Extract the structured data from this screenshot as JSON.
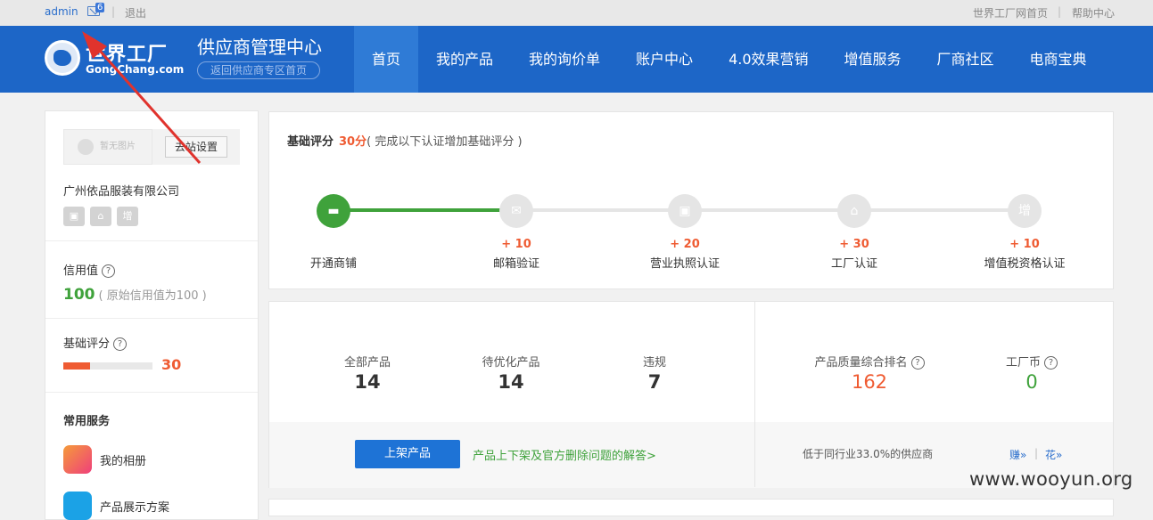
{
  "topbar": {
    "username": "admin",
    "mail_count": "6",
    "separator": "|",
    "logout": "退出",
    "site_home": "世界工厂网首页",
    "help": "帮助中心"
  },
  "header": {
    "logo_cn": "世界工厂",
    "logo_en": "GongChang.com",
    "center_title": "供应商管理中心",
    "back_link": "返回供应商专区首页",
    "nav": [
      "首页",
      "我的产品",
      "我的询价单",
      "账户中心",
      "4.0效果营销",
      "增值服务",
      "厂商社区",
      "电商宝典"
    ],
    "active_index": 0
  },
  "sidebar": {
    "no_image": "暂无图片",
    "site_settings_button": "去站设置",
    "company": "广州依品服装有限公司",
    "cert_icons": [
      "license-icon",
      "factory-icon",
      "增"
    ],
    "credit_label": "信用值",
    "credit_value": "100",
    "credit_note": "( 原始信用值为100 )",
    "score_label": "基础评分",
    "score_value": "30",
    "score_progress_percent": 30,
    "services_title": "常用服务",
    "services": [
      {
        "label": "我的相册",
        "icon": "photo-album-icon",
        "color": "#f0506e"
      },
      {
        "label": "产品展示方案",
        "icon": "product-showcase-icon",
        "color": "#1ba2e6"
      }
    ]
  },
  "score_panel": {
    "title": "基础评分",
    "score": "30分",
    "note": "( 完成以下认证增加基础评分 )",
    "steps": [
      {
        "label": "开通商铺",
        "plus": "",
        "icon": "store-icon",
        "done": true
      },
      {
        "label": "邮箱验证",
        "plus": "+ 10",
        "icon": "mail-icon",
        "done": false
      },
      {
        "label": "营业执照认证",
        "plus": "+ 20",
        "icon": "license-icon",
        "done": false
      },
      {
        "label": "工厂认证",
        "plus": "+ 30",
        "icon": "factory-icon",
        "done": false
      },
      {
        "label": "增值税资格认证",
        "plus": "+ 10",
        "icon": "增",
        "done": false
      }
    ]
  },
  "product_panel": {
    "stats": [
      {
        "label": "全部产品",
        "value": "14"
      },
      {
        "label": "待优化产品",
        "value": "14"
      },
      {
        "label": "违规",
        "value": "7"
      }
    ],
    "rank_label": "产品质量综合排名",
    "rank_value": "162",
    "coin_label": "工厂币",
    "coin_value": "0",
    "list_button": "上架产品",
    "faq_link": "产品上下架及官方删除问题的解答>",
    "rank_note": "低于同行业33.0%的供应商",
    "earn_link": "赚»",
    "spend_link": "花»",
    "footer_sep": "|"
  },
  "watermark": "www.wooyun.org",
  "colors": {
    "brand_blue": "#1d66c7",
    "green": "#3fa23b",
    "orange": "#ef5b32",
    "annotation_red": "#e0332d"
  }
}
